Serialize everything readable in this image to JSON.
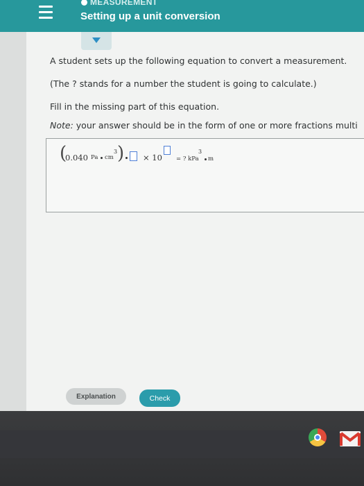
{
  "header": {
    "breadcrumb": "MEASUREMENT",
    "title": "Setting up a unit conversion"
  },
  "question": {
    "line1": "A student sets up the following equation to convert a measurement.",
    "line2": "(The ? stands for a number the student is going to calculate.)",
    "line3": "Fill in the missing part of this equation.",
    "note_label": "Note:",
    "note_text": " your answer should be in the form of one or more fractions multi"
  },
  "equation": {
    "coefficient": "0.040",
    "unit_pa": "Pa",
    "unit_cm": "cm",
    "exp_cm": "3",
    "times": "× 10",
    "rhs": "= ? kPa",
    "unit_m": "m",
    "exp_m": "3"
  },
  "buttons": {
    "explanation": "Explanation",
    "check": "Check"
  },
  "colors": {
    "header": "#27989c",
    "check_button": "#2b9cab",
    "explanation_button": "#cfd2d2",
    "input_border": "#4f80d6"
  },
  "icons": {
    "menu": "hamburger-icon",
    "toggle": "triangle-down-icon",
    "shelf": [
      "chrome-icon",
      "gmail-icon"
    ]
  }
}
